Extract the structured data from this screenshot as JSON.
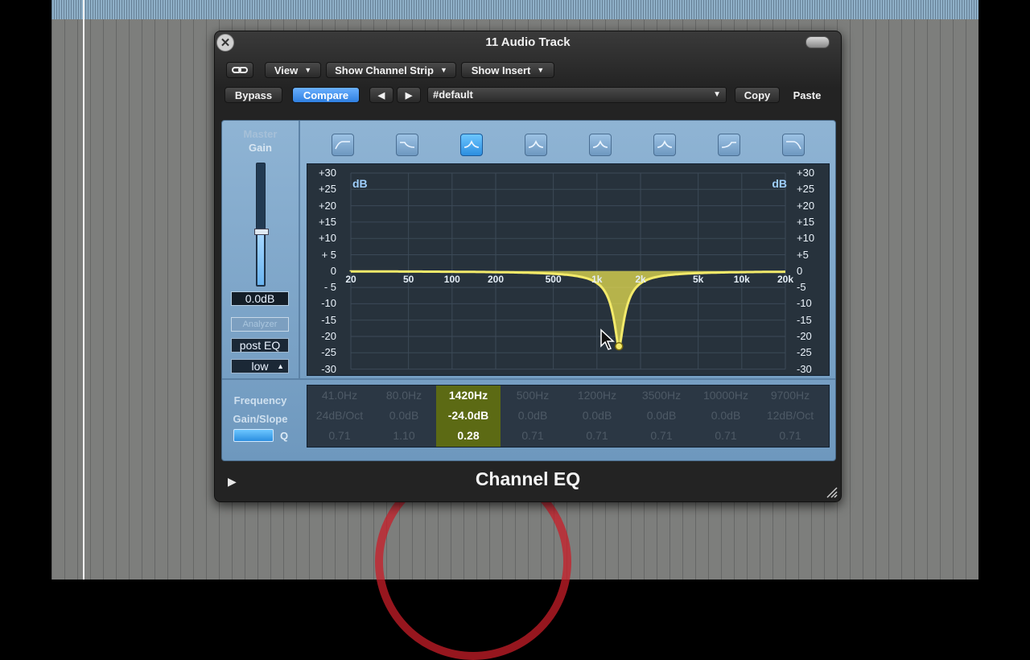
{
  "window": {
    "title": "11 Audio Track"
  },
  "toolbar": {
    "link_icon": "link-icon",
    "view_label": "View",
    "show_channel_strip_label": "Show Channel Strip",
    "show_insert_label": "Show Insert",
    "bypass_label": "Bypass",
    "compare_label": "Compare",
    "prev_label": "◀",
    "next_label": "▶",
    "preset_value": "#default",
    "copy_label": "Copy",
    "paste_label": "Paste"
  },
  "master": {
    "label_line1": "Master",
    "label_line2": "Gain",
    "gain_value": "0.0dB",
    "slider_level": 0.56
  },
  "side_buttons": {
    "analyzer_label": "Analyzer",
    "post_eq_label": "post EQ",
    "resolution_label": "low"
  },
  "graph": {
    "db_unit": "dB",
    "db_ticks": [
      "+30",
      "+25",
      "+20",
      "+15",
      "+10",
      "+ 5",
      "0",
      "- 5",
      "-10",
      "-15",
      "-20",
      "-25",
      "-30"
    ],
    "db_ticks_right": [
      "+30",
      "+25",
      "+20",
      "+15",
      "+10",
      "+5",
      "0",
      "-5",
      "-10",
      "-15",
      "-20",
      "-25",
      "-30"
    ],
    "freq_ticks": [
      "20",
      "50",
      "100",
      "200",
      "500",
      "1k",
      "2k",
      "5k",
      "10k",
      "20k"
    ]
  },
  "band_icons": [
    "low-cut-icon",
    "low-shelf-icon",
    "parametric-bell-icon",
    "parametric-bell-icon",
    "parametric-bell-icon",
    "parametric-bell-icon",
    "high-shelf-icon",
    "high-cut-icon"
  ],
  "param_labels": {
    "frequency": "Frequency",
    "gain_slope": "Gain/Slope",
    "q": "Q"
  },
  "bands": [
    {
      "freq": "41.0Hz",
      "gain": "24dB/Oct",
      "q": "0.71",
      "active": false
    },
    {
      "freq": "80.0Hz",
      "gain": "0.0dB",
      "q": "1.10",
      "active": false
    },
    {
      "freq": "1420Hz",
      "gain": "-24.0dB",
      "q": "0.28",
      "active": true
    },
    {
      "freq": "500Hz",
      "gain": "0.0dB",
      "q": "0.71",
      "active": false
    },
    {
      "freq": "1200Hz",
      "gain": "0.0dB",
      "q": "0.71",
      "active": false
    },
    {
      "freq": "3500Hz",
      "gain": "0.0dB",
      "q": "0.71",
      "active": false
    },
    {
      "freq": "10000Hz",
      "gain": "0.0dB",
      "q": "0.71",
      "active": false
    },
    {
      "freq": "9700Hz",
      "gain": "12dB/Oct",
      "q": "0.71",
      "active": false
    }
  ],
  "footer": {
    "plugin_name": "Channel EQ",
    "play_icon": "play-triangle-icon"
  },
  "colors": {
    "curve": "#f3ea6a",
    "curve_fill": "#e7df50",
    "accent": "#2f7fe0",
    "panel": "#7fa6ca"
  }
}
